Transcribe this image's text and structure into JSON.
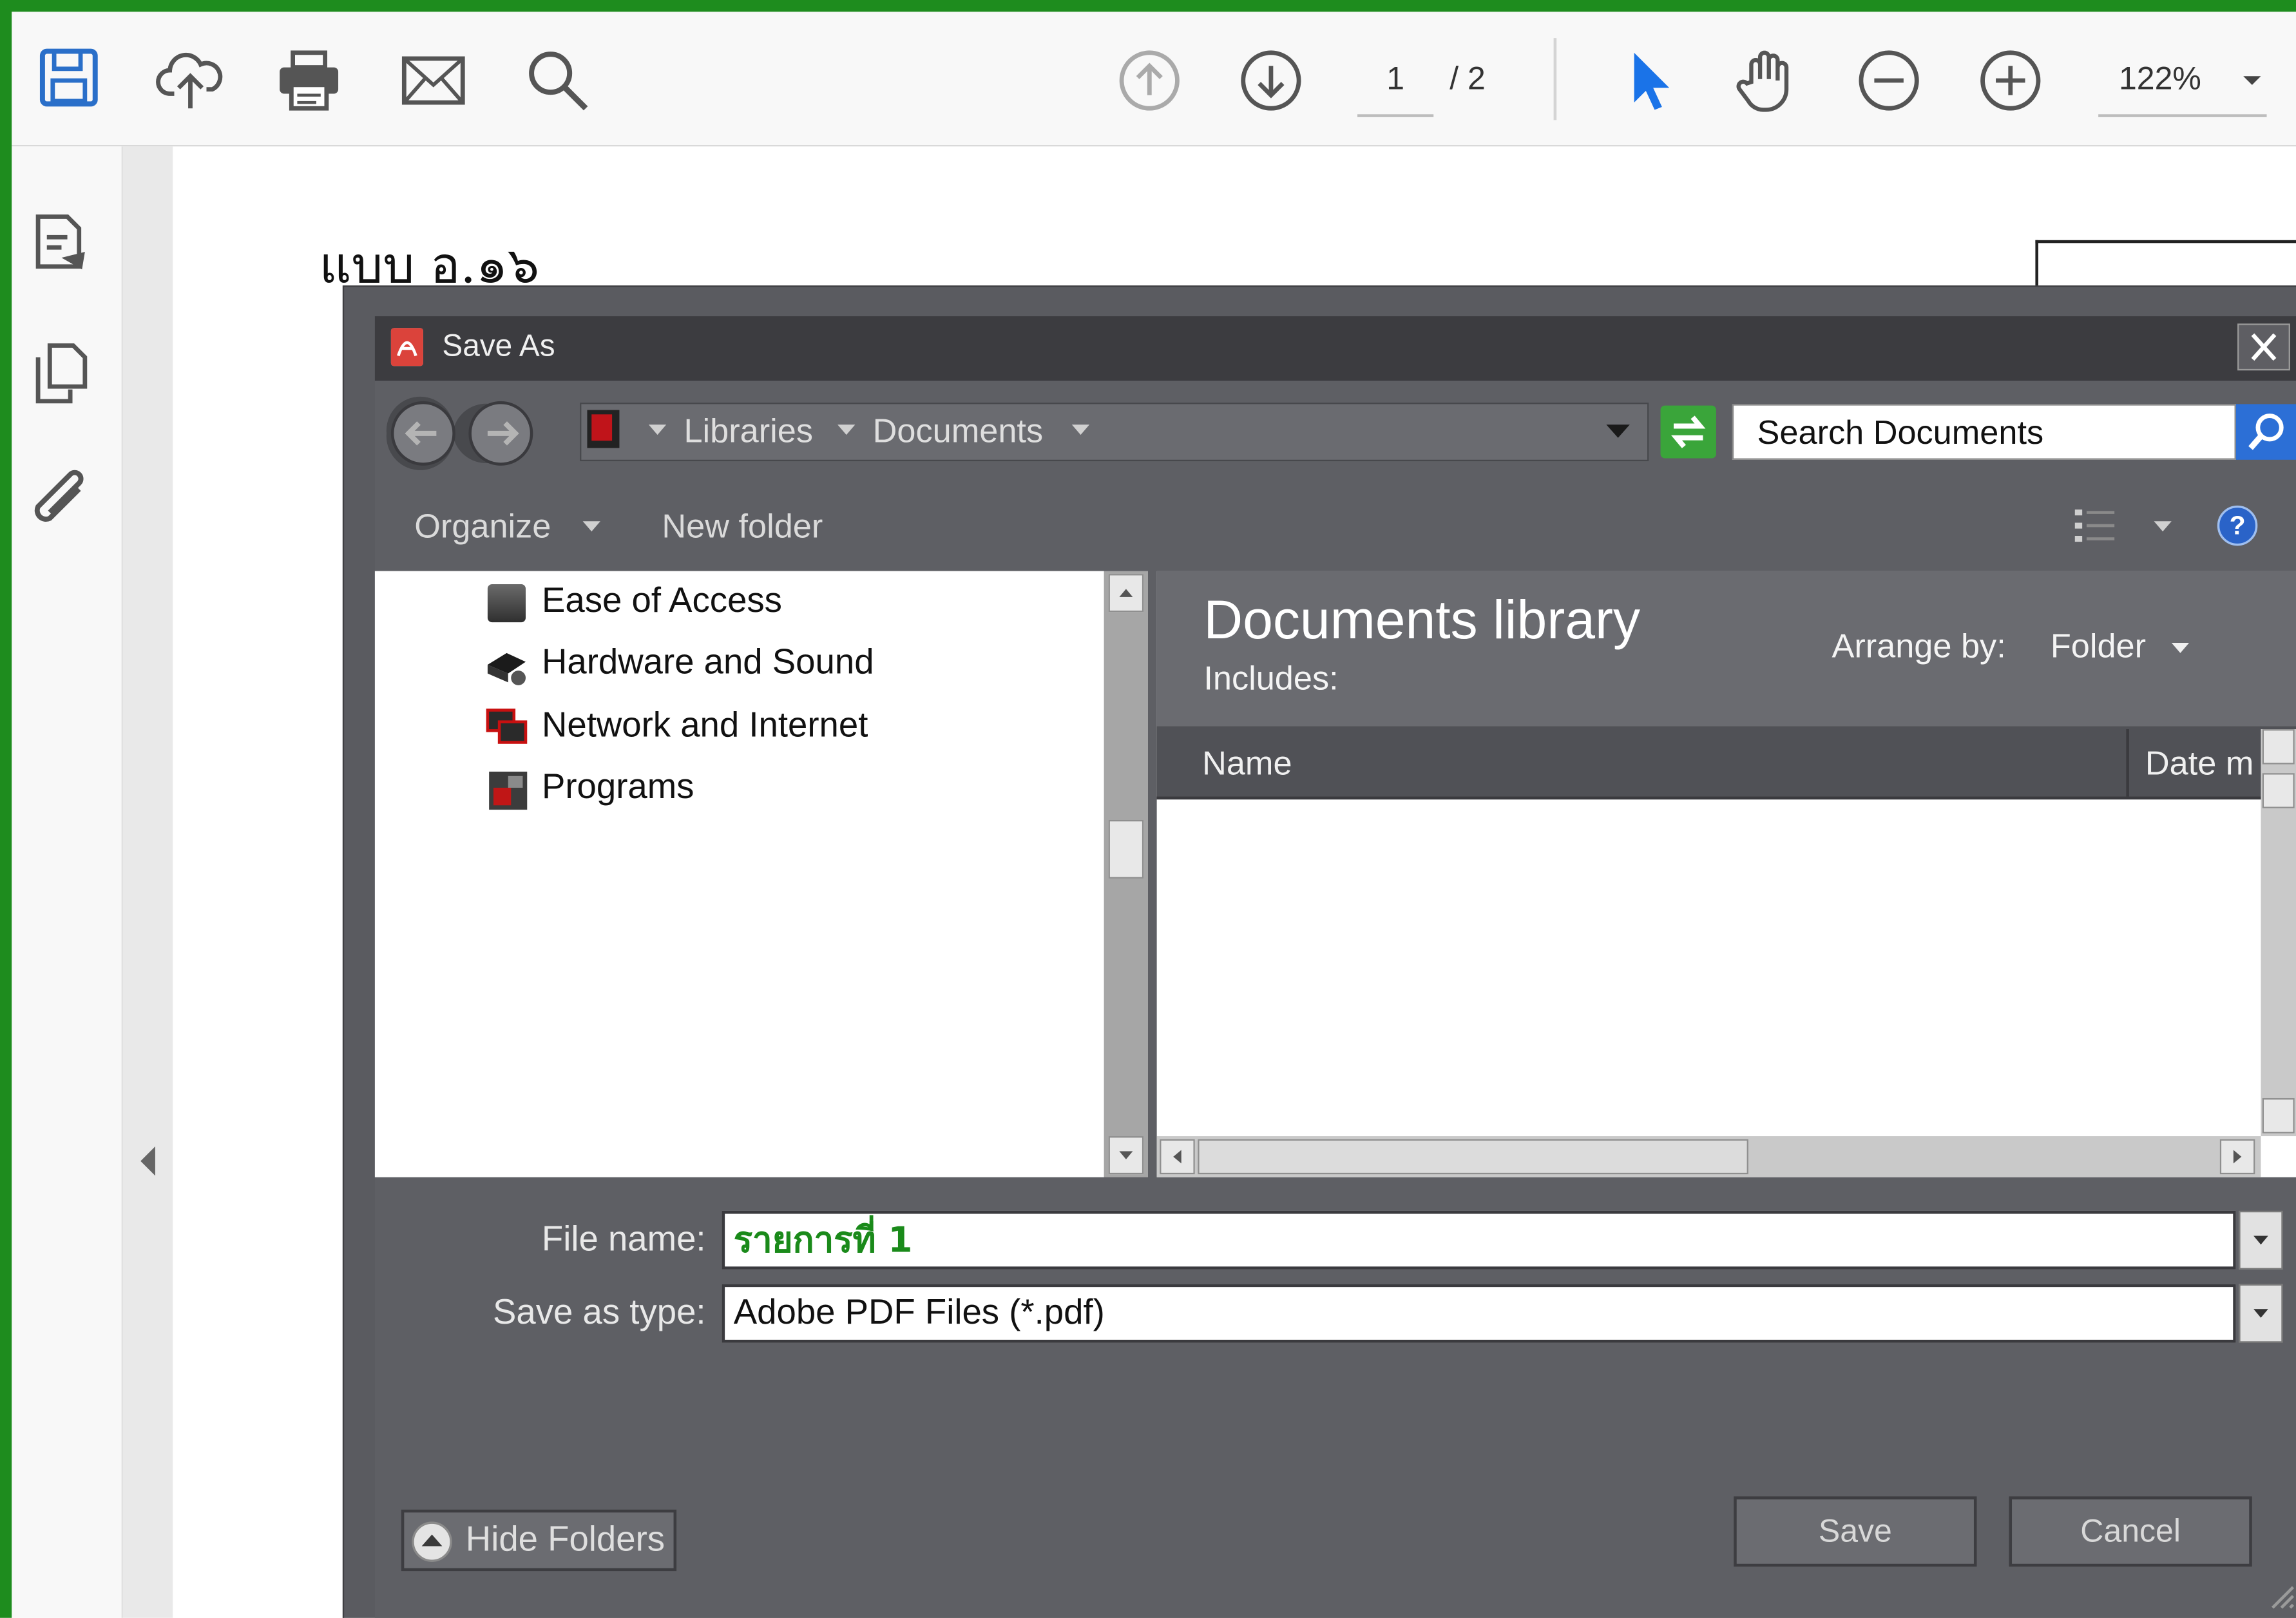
{
  "toolbar": {
    "page_current": "1",
    "page_total": "/ 2",
    "zoom": "122%"
  },
  "document": {
    "title": "แบบ อ.๑๖"
  },
  "dialog": {
    "title": "Save As",
    "breadcrumb": [
      "Libraries",
      "Documents"
    ],
    "search_text": "Search Documents",
    "commands": {
      "organize": "Organize",
      "new_folder": "New folder"
    },
    "tree_items": [
      {
        "label": "Ease of Access",
        "icon": "ease-of-access-icon"
      },
      {
        "label": "Hardware and Sound",
        "icon": "hardware-sound-icon"
      },
      {
        "label": "Network and Internet",
        "icon": "network-icon"
      },
      {
        "label": "Programs",
        "icon": "programs-icon"
      }
    ],
    "library": {
      "title": "Documents library",
      "includes": "Includes:",
      "arrange_label": "Arrange by:",
      "arrange_value": "Folder"
    },
    "columns": {
      "name": "Name",
      "date": "Date m"
    },
    "filename_label": "File name:",
    "filename_value": "รายการที่ 1",
    "type_label": "Save as type:",
    "type_value": "Adobe PDF Files (*.pdf)",
    "hide_folders": "Hide Folders",
    "save": "Save",
    "cancel": "Cancel"
  },
  "colors": {
    "frame_green": "#1e8c1e",
    "filename_green": "#1a8a1a",
    "cursor_blue": "#1a73e8"
  }
}
